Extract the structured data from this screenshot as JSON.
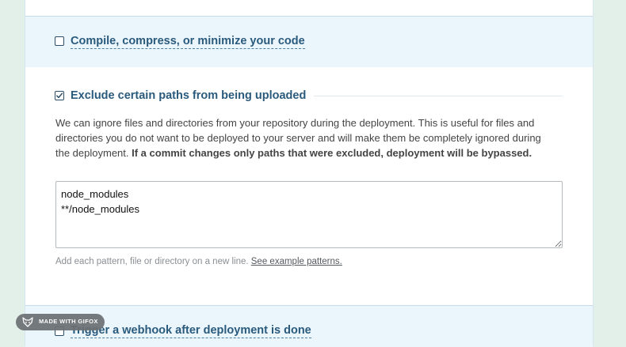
{
  "options": {
    "compile": {
      "label": "Compile, compress, or minimize your code",
      "checked": false
    },
    "exclude": {
      "label": "Exclude certain paths from being uploaded",
      "checked": true,
      "description": "We can ignore files and directories from your repository during the deployment. This is useful for files and directories you do not want to be deployed to your server and will make them be completely ignored during the deployment. ",
      "description_bold": "If a commit changes only paths that were excluded, deployment will be bypassed.",
      "textarea_value": "node_modules\n**/node_modules",
      "hint_text": "Add each pattern, file or directory on a new line. ",
      "hint_link": "See example patterns."
    },
    "webhook": {
      "label": "Trigger a webhook after deployment is done",
      "checked": false
    }
  },
  "watermark": {
    "text": "MADE WITH GIFOX",
    "icon": "fox-icon"
  },
  "colors": {
    "accent": "#2a5a7c",
    "section_highlight": "#eaf5fc",
    "page_background": "#e3efe9"
  }
}
